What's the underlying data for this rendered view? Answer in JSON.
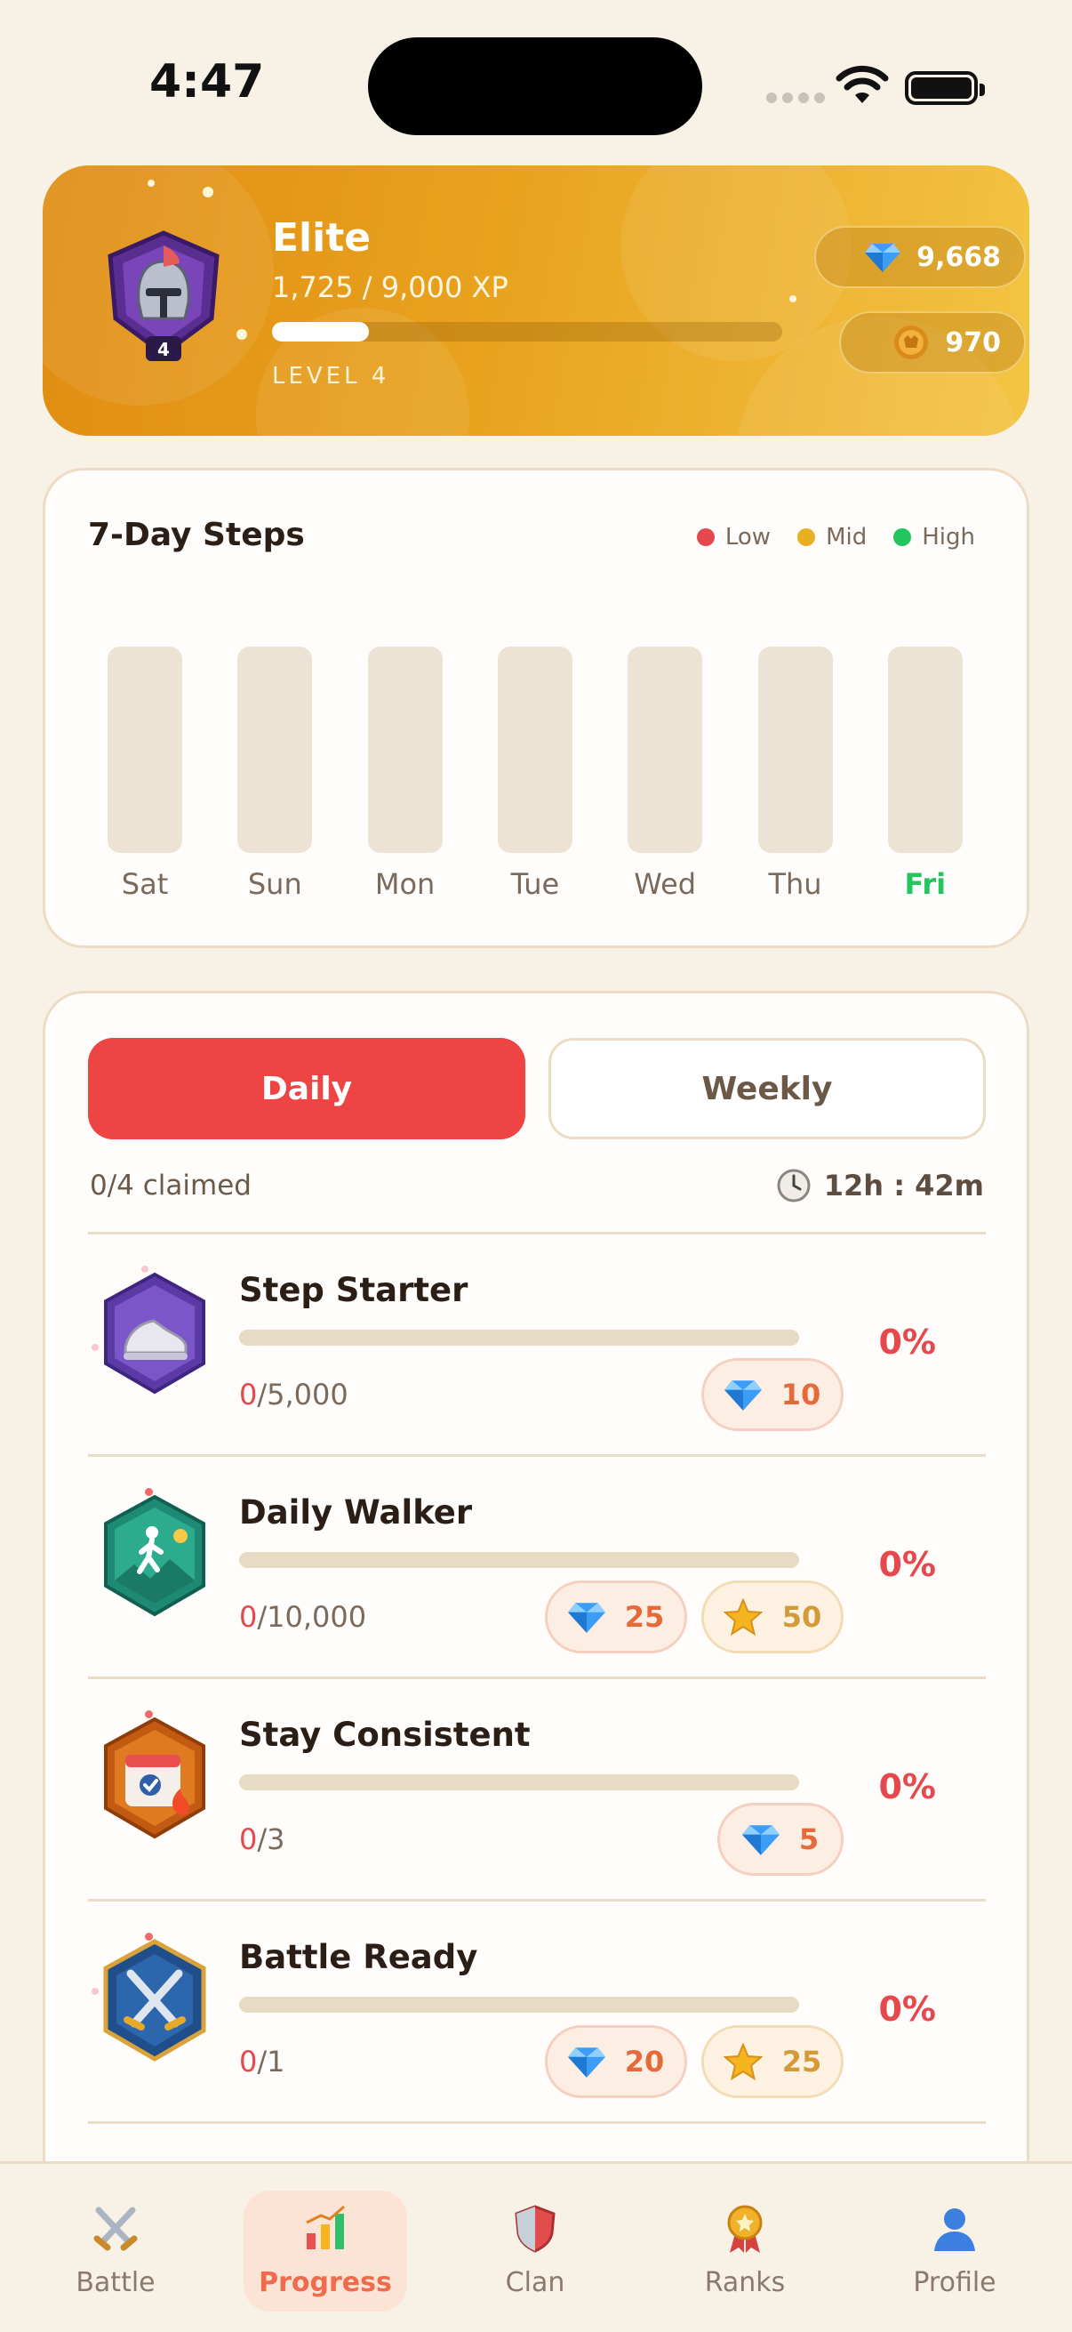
{
  "status_bar": {
    "time": "4:47"
  },
  "header": {
    "rank_title": "Elite",
    "xp_text": "1,725 / 9,000 XP",
    "xp_fraction": 0.19,
    "level_text": "LEVEL 4",
    "badge_level": "4",
    "gems": "9,668",
    "coins": "970"
  },
  "steps_chart": {
    "title": "7-Day Steps",
    "legend": [
      {
        "label": "Low",
        "color": "#e5484d"
      },
      {
        "label": "Mid",
        "color": "#e8b020"
      },
      {
        "label": "High",
        "color": "#22c55e"
      }
    ],
    "today_color": "#22c55e"
  },
  "chart_data": {
    "type": "bar",
    "title": "7-Day Steps",
    "categories": [
      "Sat",
      "Sun",
      "Mon",
      "Tue",
      "Wed",
      "Thu",
      "Fri"
    ],
    "values": [
      0,
      0,
      0,
      0,
      0,
      0,
      0
    ],
    "highlighted_category": "Fri",
    "legend": [
      "Low",
      "Mid",
      "High"
    ],
    "legend_position": "top-right",
    "grid": false
  },
  "quests": {
    "tabs": {
      "daily": "Daily",
      "weekly": "Weekly",
      "active": "daily"
    },
    "claimed_text": "0/4 claimed",
    "timer_text": "12h : 42m",
    "items": [
      {
        "title": "Step Starter",
        "current": "0",
        "target": "/5,000",
        "percent": "0%",
        "rewards": [
          {
            "type": "gem",
            "amount": "10"
          }
        ],
        "icon": "sneaker-icon"
      },
      {
        "title": "Daily Walker",
        "current": "0",
        "target": "/10,000",
        "percent": "0%",
        "rewards": [
          {
            "type": "gem",
            "amount": "25"
          },
          {
            "type": "star",
            "amount": "50"
          }
        ],
        "icon": "walker-icon"
      },
      {
        "title": "Stay Consistent",
        "current": "0",
        "target": "/3",
        "percent": "0%",
        "rewards": [
          {
            "type": "gem",
            "amount": "5"
          }
        ],
        "icon": "calendar-fire-icon"
      },
      {
        "title": "Battle Ready",
        "current": "0",
        "target": "/1",
        "percent": "0%",
        "rewards": [
          {
            "type": "gem",
            "amount": "20"
          },
          {
            "type": "star",
            "amount": "25"
          }
        ],
        "icon": "crossed-swords-icon"
      }
    ]
  },
  "nav": {
    "active": "progress",
    "items": [
      {
        "id": "battle",
        "label": "Battle",
        "icon": "swords-icon"
      },
      {
        "id": "progress",
        "label": "Progress",
        "icon": "bar-chart-icon"
      },
      {
        "id": "clan",
        "label": "Clan",
        "icon": "shield-icon"
      },
      {
        "id": "ranks",
        "label": "Ranks",
        "icon": "medal-icon"
      },
      {
        "id": "profile",
        "label": "Profile",
        "icon": "person-icon"
      }
    ]
  }
}
